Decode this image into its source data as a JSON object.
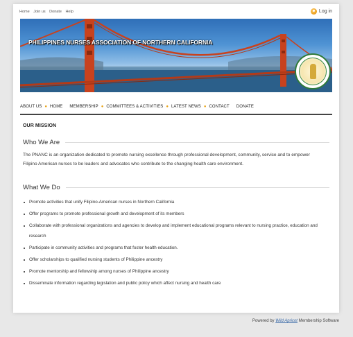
{
  "top_links": [
    "Home",
    "Join us",
    "Donate",
    "Help"
  ],
  "login_label": "Log in",
  "banner": {
    "title": "PHILIPPINES NURSES ASSOCIATION OF NORTHERN CALIFORNIA"
  },
  "nav": [
    {
      "label": "ABOUT US",
      "dot": true
    },
    {
      "label": "HOME",
      "dot": false
    },
    {
      "label": "MEMBERSHIP",
      "dot": true
    },
    {
      "label": "COMMITTEES & ACTIVITIES",
      "dot": true
    },
    {
      "label": "LATEST NEWS",
      "dot": true
    },
    {
      "label": "CONTACT",
      "dot": false
    },
    {
      "label": "DONATE",
      "dot": false
    }
  ],
  "content": {
    "mission": "OUR MISSION",
    "who_title": "Who We Are",
    "who_text": "The PNANC is an organization dedicated to promote nursing excellence through professional development, community, service and to empower Filipino American nurses to be leaders and advocates who contribute to the changing health care environment.",
    "what_title": "What We Do",
    "what_items": [
      "Promote activities that unify Filipino-American nurses in Northern California",
      "Offer programs to promote professional growth and development of its members",
      "Collaborate with professional organizations and agencies to develop and implement educational programs relevant to nursing practice, education and research",
      "Participate in community activities and programs that foster health education.",
      "Offer scholarships to qualified nursing students of Philippine ancestry",
      "Promote mentorship and fellowship among nurses of Philippine ancestry",
      "Disseminate information regarding legislation and public policy which affect nursing and health care"
    ]
  },
  "footer": {
    "powered": "Powered by",
    "brand": "Wild Apricot",
    "suffix": "Membership Software"
  },
  "colors": {
    "accent_dot": "#e7a010",
    "bridge": "#c8421e",
    "link": "#3a6aa8"
  }
}
